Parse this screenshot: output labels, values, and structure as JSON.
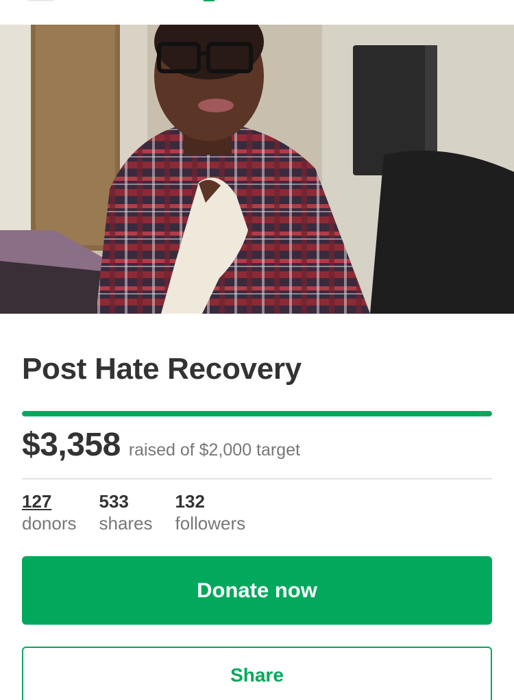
{
  "campaign": {
    "title": "Post Hate Recovery",
    "hero_image_alt": "campaign photo"
  },
  "funding": {
    "raised": "$3,358",
    "raised_caption": "raised of $2,000 target",
    "progress_fraction": 1.0
  },
  "stats": [
    {
      "value": "127",
      "label": "donors"
    },
    {
      "value": "533",
      "label": "shares"
    },
    {
      "value": "132",
      "label": "followers"
    }
  ],
  "actions": {
    "donate_label": "Donate now",
    "share_label": "Share"
  },
  "colors": {
    "brand_green": "#02a95c",
    "text_dark": "#333333",
    "text_muted": "#777777"
  }
}
